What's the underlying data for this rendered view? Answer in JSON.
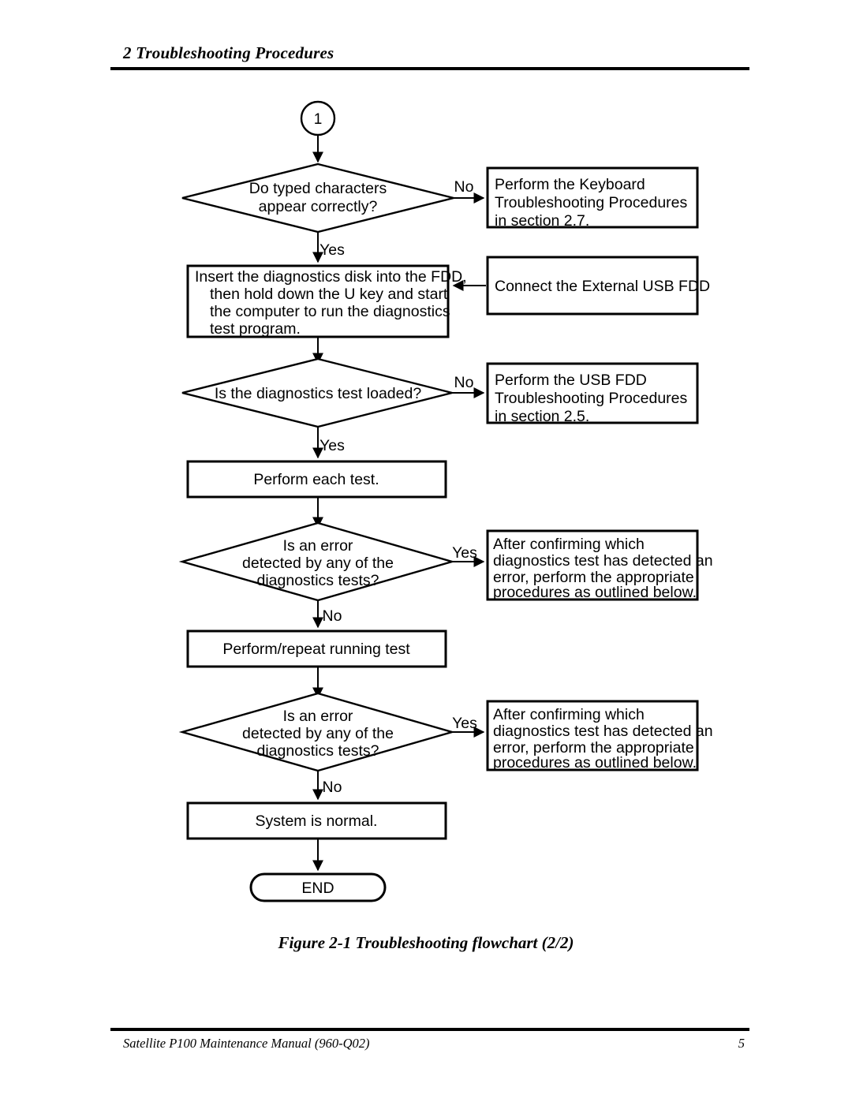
{
  "header": {
    "title": "2 Troubleshooting Procedures"
  },
  "figure": {
    "caption": "Figure 2-1 Troubleshooting flowchart (2/2)"
  },
  "footer": {
    "manual": "Satellite P100 Maintenance Manual (960-Q02)",
    "page_number": "5"
  },
  "chart_data": {
    "type": "diagram",
    "diagram_kind": "flowchart",
    "title": "Figure 2-1 Troubleshooting flowchart (2/2)",
    "nodes": [
      {
        "id": "connector-1",
        "kind": "connector",
        "label": "1"
      },
      {
        "id": "decision-typed-characters",
        "kind": "decision",
        "lines": [
          "Do typed characters",
          "appear correctly?"
        ]
      },
      {
        "id": "process-keyboard-troubleshooting",
        "kind": "process",
        "lines": [
          "Perform the Keyboard",
          "Troubleshooting Procedures",
          "in section 2.7."
        ]
      },
      {
        "id": "process-insert-diagnostics-disk",
        "kind": "process",
        "lines": [
          "Insert the diagnostics disk into the FDD,",
          "then hold down the U key and start",
          "the computer to run the diagnostics",
          "test program."
        ]
      },
      {
        "id": "process-connect-external-usb-fdd",
        "kind": "process",
        "lines": [
          "Connect the External USB FDD"
        ]
      },
      {
        "id": "decision-diagnostics-test-loaded",
        "kind": "decision",
        "lines": [
          "Is the diagnostics test loaded?"
        ]
      },
      {
        "id": "process-usb-fdd-troubleshooting",
        "kind": "process",
        "lines": [
          "Perform the USB FDD",
          "Troubleshooting Procedures",
          "in section 2.5."
        ]
      },
      {
        "id": "process-perform-each-test",
        "kind": "process",
        "lines": [
          "Perform each test."
        ]
      },
      {
        "id": "decision-error-detected-1",
        "kind": "decision",
        "lines": [
          "Is an error",
          "detected by any of the",
          "diagnostics tests?"
        ]
      },
      {
        "id": "process-after-confirming-1",
        "kind": "process",
        "lines": [
          "After confirming which",
          "diagnostics test has detected an",
          "error, perform the appropriate",
          "procedures as outlined below."
        ]
      },
      {
        "id": "process-perform-repeat-running-test",
        "kind": "process",
        "lines": [
          "Perform/repeat running test"
        ]
      },
      {
        "id": "decision-error-detected-2",
        "kind": "decision",
        "lines": [
          "Is an error",
          "detected by any of the",
          "diagnostics tests?"
        ]
      },
      {
        "id": "process-after-confirming-2",
        "kind": "process",
        "lines": [
          "After confirming which",
          "diagnostics test has detected an",
          "error, perform the appropriate",
          "procedures as outlined below."
        ]
      },
      {
        "id": "process-system-is-normal",
        "kind": "process",
        "lines": [
          "System is normal."
        ]
      },
      {
        "id": "terminator-end",
        "kind": "terminator",
        "label": "END"
      }
    ],
    "edges": [
      {
        "from": "connector-1",
        "to": "decision-typed-characters",
        "label": ""
      },
      {
        "from": "decision-typed-characters",
        "to": "process-keyboard-troubleshooting",
        "label": "No"
      },
      {
        "from": "decision-typed-characters",
        "to": "process-insert-diagnostics-disk",
        "label": "Yes"
      },
      {
        "from": "process-connect-external-usb-fdd",
        "to": "process-insert-diagnostics-disk",
        "label": ""
      },
      {
        "from": "process-insert-diagnostics-disk",
        "to": "decision-diagnostics-test-loaded",
        "label": ""
      },
      {
        "from": "decision-diagnostics-test-loaded",
        "to": "process-usb-fdd-troubleshooting",
        "label": "No"
      },
      {
        "from": "decision-diagnostics-test-loaded",
        "to": "process-perform-each-test",
        "label": "Yes"
      },
      {
        "from": "process-perform-each-test",
        "to": "decision-error-detected-1",
        "label": ""
      },
      {
        "from": "decision-error-detected-1",
        "to": "process-after-confirming-1",
        "label": "Yes"
      },
      {
        "from": "decision-error-detected-1",
        "to": "process-perform-repeat-running-test",
        "label": "No"
      },
      {
        "from": "process-perform-repeat-running-test",
        "to": "decision-error-detected-2",
        "label": ""
      },
      {
        "from": "decision-error-detected-2",
        "to": "process-after-confirming-2",
        "label": "Yes"
      },
      {
        "from": "decision-error-detected-2",
        "to": "process-system-is-normal",
        "label": "No"
      },
      {
        "from": "process-system-is-normal",
        "to": "terminator-end",
        "label": ""
      }
    ],
    "colors": {
      "stroke": "#000000",
      "fill": "#ffffff",
      "text": "#000000"
    }
  },
  "flow": {
    "connector_1": "1",
    "d1": {
      "l1": "Do typed characters",
      "l2": "appear correctly?"
    },
    "b_keyboard": {
      "l1": "Perform the Keyboard",
      "l2": "Troubleshooting Procedures",
      "l3": "in section 2.7."
    },
    "b_insert": {
      "l1": "Insert the diagnostics disk into the FDD,",
      "l2": "then hold down the U key and start",
      "l3": "the computer to run the diagnostics",
      "l4": "test program."
    },
    "b_usbfdd_connect": {
      "l1": "Connect the External USB FDD"
    },
    "d2": {
      "l1": "Is the diagnostics test loaded?"
    },
    "b_usbfdd": {
      "l1": "Perform the USB FDD",
      "l2": "Troubleshooting Procedures",
      "l3": "in section 2.5."
    },
    "b_each_test": {
      "l1": "Perform each test."
    },
    "d3": {
      "l1": "Is an error",
      "l2": "detected by any of the",
      "l3": "diagnostics tests?"
    },
    "b_confirm1": {
      "l1": "After confirming which",
      "l2": "diagnostics test has detected an",
      "l3": "error, perform the appropriate",
      "l4": "procedures as outlined below."
    },
    "b_repeat": {
      "l1": "Perform/repeat running test"
    },
    "d4": {
      "l1": "Is an error",
      "l2": "detected by any of the",
      "l3": "diagnostics tests?"
    },
    "b_confirm2": {
      "l1": "After confirming which",
      "l2": "diagnostics test has detected an",
      "l3": "error, perform the appropriate",
      "l4": "procedures as outlined below."
    },
    "b_normal": {
      "l1": "System is normal."
    },
    "b_end": "END",
    "labels": {
      "no1": "No",
      "yes1": "Yes",
      "no2": "No",
      "yes2": "Yes",
      "yes3": "Yes",
      "no3": "No",
      "yes4": "Yes",
      "no4": "No"
    }
  }
}
